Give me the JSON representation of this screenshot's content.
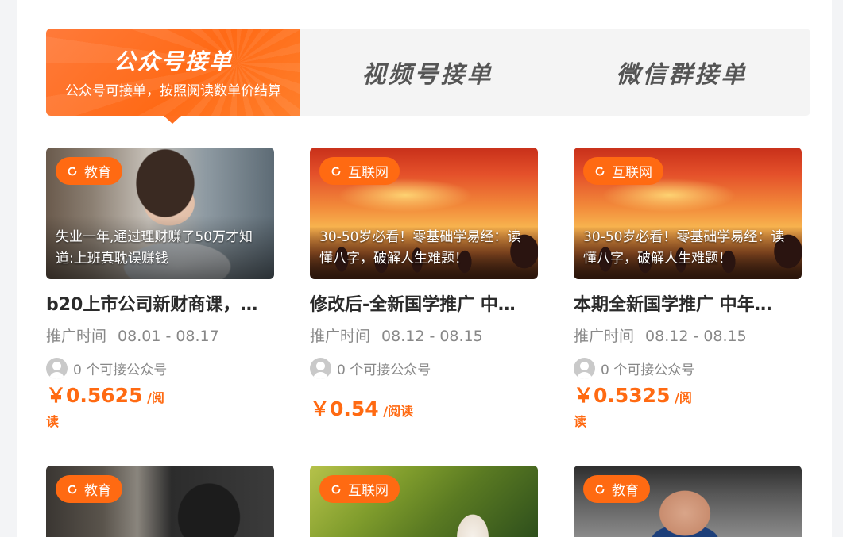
{
  "tabs": {
    "active": {
      "title": "公众号接单",
      "subtitle": "公众号可接单，按照阅读数单价结算"
    },
    "video": {
      "label": "视频号接单"
    },
    "group": {
      "label": "微信群接单"
    }
  },
  "common": {
    "promo_label": "推广时间",
    "price_unit": "/阅读"
  },
  "cards": [
    {
      "category": "教育",
      "overlay_text": "失业一年,通过理财赚了50万才知道:上班真耽误赚钱",
      "title": "b20上市公司新财商课，…",
      "promo_dates": "08.01 - 08.17",
      "accounts_text": "0 个可接公众号",
      "price": "￥0.5625"
    },
    {
      "category": "互联网",
      "overlay_text": "30-50岁必看！零基础学易经：读懂八字，破解人生难题！",
      "title": "修改后-全新国学推广 中…",
      "promo_dates": "08.12 - 08.15",
      "accounts_text": "0 个可接公众号",
      "price": "￥0.54"
    },
    {
      "category": "互联网",
      "overlay_text": "30-50岁必看！零基础学易经：读懂八字，破解人生难题！",
      "title": "本期全新国学推广 中年…",
      "promo_dates": "08.12 - 08.15",
      "accounts_text": "0 个可接公众号",
      "price": "￥0.5325"
    },
    {
      "category": "教育"
    },
    {
      "category": "互联网"
    },
    {
      "category": "教育"
    }
  ],
  "colors": {
    "accent": "#ff6a12",
    "tab_bg": "#f4f4f4"
  },
  "icons": {
    "badge": "refresh-circle-icon",
    "avatar": "user-avatar-icon"
  }
}
